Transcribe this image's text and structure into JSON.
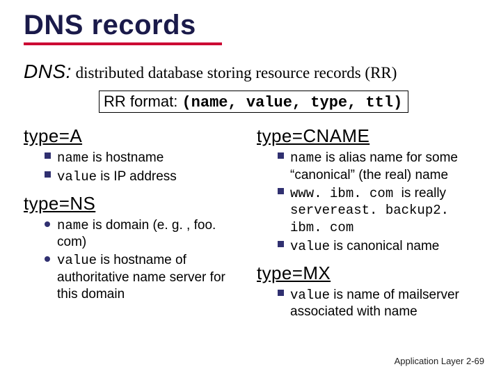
{
  "title": "DNS records",
  "intro": {
    "lead": "DNS:",
    "rest": " distributed database storing resource records (RR)"
  },
  "rr": {
    "label": "RR format: ",
    "tuple": "(name, value, type, ttl)"
  },
  "left": {
    "typeA": {
      "heading": "type=A",
      "b1_pre": "name",
      "b1_post": " is hostname",
      "b2_pre": "value",
      "b2_post": " is IP address"
    },
    "typeNS": {
      "heading": "type=NS",
      "b1_pre": "name",
      "b1_post": " is domain (e. g. , foo. com)",
      "b2_pre": "value",
      "b2_post": " is hostname of authoritative name server for this domain"
    }
  },
  "right": {
    "typeCNAME": {
      "heading": "type=CNAME",
      "b1_pre": "name",
      "b1_post": " is alias name for some “canonical” (the real) name",
      "b2_pre": "www. ibm. com ",
      "b2_mid": " is really ",
      "b2_post": "servereast. backup2. ibm. com",
      "b3_pre": "value",
      "b3_post": " is canonical name"
    },
    "typeMX": {
      "heading": "type=MX",
      "b1_pre": "value",
      "b1_post": " is name of mailserver associated with name"
    }
  },
  "footer": {
    "label": "Application Layer ",
    "page": "2-69"
  }
}
